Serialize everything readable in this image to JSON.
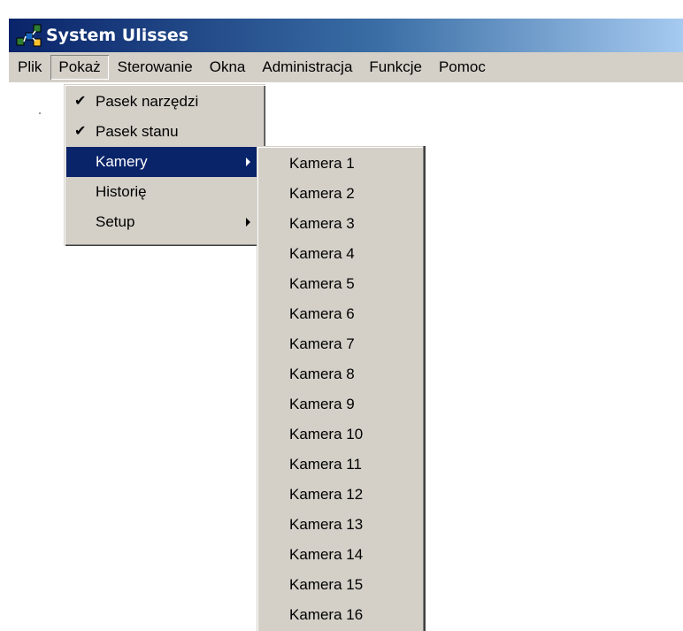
{
  "window": {
    "title": "System Ulisses",
    "icon": "app-network-icon"
  },
  "menubar": {
    "items": [
      {
        "label": "Plik"
      },
      {
        "label": "Pokaż"
      },
      {
        "label": "Sterowanie"
      },
      {
        "label": "Okna"
      },
      {
        "label": "Administracja"
      },
      {
        "label": "Funkcje"
      },
      {
        "label": "Pomoc"
      }
    ],
    "active": "Pokaż"
  },
  "view_menu": {
    "items": [
      {
        "label": "Pasek narzędzi",
        "checked": true
      },
      {
        "label": "Pasek stanu",
        "checked": true
      },
      {
        "label": "Kamery",
        "submenu": true,
        "highlighted": true
      },
      {
        "label": "Historię"
      },
      {
        "label": "Setup",
        "submenu": true
      }
    ],
    "check_glyph": "✔"
  },
  "cameras_menu": {
    "items": [
      {
        "label": "Kamera 1"
      },
      {
        "label": "Kamera 2"
      },
      {
        "label": "Kamera 3"
      },
      {
        "label": "Kamera 4"
      },
      {
        "label": "Kamera 5"
      },
      {
        "label": "Kamera 6"
      },
      {
        "label": "Kamera 7"
      },
      {
        "label": "Kamera 8"
      },
      {
        "label": "Kamera 9"
      },
      {
        "label": "Kamera 10"
      },
      {
        "label": "Kamera 11"
      },
      {
        "label": "Kamera 12"
      },
      {
        "label": "Kamera 13"
      },
      {
        "label": "Kamera 14"
      },
      {
        "label": "Kamera 15"
      },
      {
        "label": "Kamera 16"
      }
    ]
  },
  "colors": {
    "highlight": "#0a246a",
    "menu_bg": "#d4d0c8",
    "title_start": "#0a246a",
    "title_end": "#a6caf0"
  }
}
